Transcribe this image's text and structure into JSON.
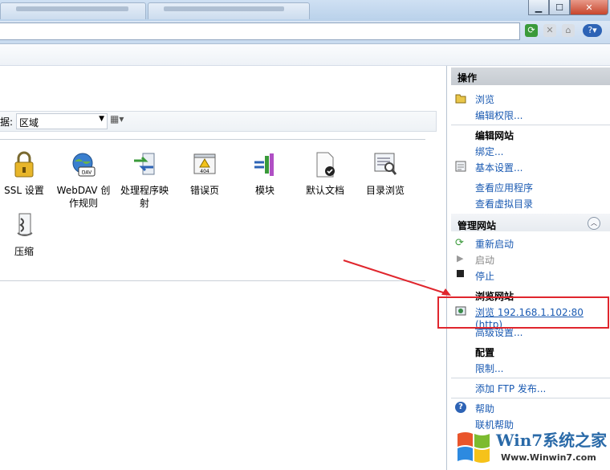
{
  "groupby": {
    "label": "据:",
    "value": "区域"
  },
  "features": [
    {
      "label": "SSL 设置",
      "icon": "lock-icon"
    },
    {
      "label": "WebDAV 创作规则",
      "icon": "webdav-icon"
    },
    {
      "label": "处理程序映射",
      "icon": "handler-mappings-icon"
    },
    {
      "label": "错误页",
      "icon": "error-page-icon"
    },
    {
      "label": "模块",
      "icon": "modules-icon"
    },
    {
      "label": "默认文档",
      "icon": "default-document-icon"
    },
    {
      "label": "目录浏览",
      "icon": "directory-browsing-icon"
    },
    {
      "label": "压缩",
      "icon": "compression-icon"
    }
  ],
  "actions": {
    "title": "操作",
    "explore": "浏览",
    "edit_permissions": "编辑权限...",
    "edit_site": "编辑网站",
    "bindings": "绑定...",
    "basic_settings": "基本设置...",
    "view_apps": "查看应用程序",
    "view_vdirs": "查看虚拟目录",
    "manage_site": "管理网站",
    "restart": "重新启动",
    "start": "启动",
    "stop": "停止",
    "browse_site": "浏览网站",
    "browse_url": "浏览 192.168.1.102:80 (http)",
    "advanced": "高级设置...",
    "configure": "配置",
    "limits": "限制...",
    "add_ftp": "添加 FTP 发布...",
    "help": "帮助",
    "online_help": "联机帮助"
  },
  "watermark": {
    "brand": "Win7系统之家",
    "url": "Www.Winwin7.com"
  },
  "colors": {
    "link": "#1a5ab2",
    "highlight": "#e0262d",
    "arrow": "#e0262d"
  }
}
